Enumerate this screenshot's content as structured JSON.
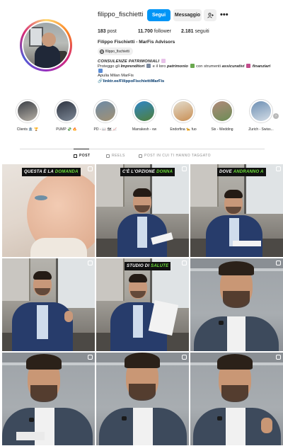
{
  "profile": {
    "username": "filippo_fischietti",
    "follow_label": "Segui",
    "message_label": "Messaggio",
    "add_user_icon": "add-user-icon",
    "more_icon": "•••",
    "stats": {
      "posts_value": "183",
      "posts_label": "post",
      "followers_value": "11.700",
      "followers_label": "follower",
      "following_value": "2.181",
      "following_label": "seguiti"
    },
    "full_name": "Filippo Fischietti - MarFis Advisors",
    "threads_handle": "filippo_fischietti",
    "bio": {
      "line1": "CONSULENZE PATRIMONIALI",
      "line2_a": "Proteggo gli",
      "line2_b": "Imprenditori",
      "line2_c": "e il loro",
      "line2_d": "patrimonio",
      "line2_e": "con strumenti",
      "line2_f": "assicurativi",
      "line2_g": "finanziari",
      "line4": "Apulia Milan MarFis",
      "link": "linktr.ee/FilippoFischiettiMarFis"
    }
  },
  "highlights": [
    {
      "label": "Clients 🏦 🏆",
      "color1": "#3b3f46",
      "color2": "#b7b1a7"
    },
    {
      "label": "PUMP 💸 🔥",
      "color1": "#2e3441",
      "color2": "#7d8896"
    },
    {
      "label": "PD - 📖 🗺 📈",
      "color1": "#6d8aa6",
      "color2": "#a29173"
    },
    {
      "label": "Marrakesh - vw",
      "color1": "#2f86c6",
      "color2": "#4f7f3a"
    },
    {
      "label": "Endorfina 🐆 fuo",
      "color1": "#e3dccd",
      "color2": "#c98f54"
    },
    {
      "label": "Six - Wedding",
      "color1": "#b08a7a",
      "color2": "#6b8c55"
    },
    {
      "label": "Zurich - Swiss...",
      "color1": "#6d8fb3",
      "color2": "#d4dde6"
    }
  ],
  "tabs": {
    "posts": "POST",
    "reels": "REELS",
    "tagged": "POST IN CUI TI HANNO TAGGATO"
  },
  "posts": [
    {
      "caption_a": "QUESTA È LA",
      "caption_b": "DOMANDA"
    },
    {
      "caption_a": "C'È L'OPZIONE",
      "caption_b": "DONNA"
    },
    {
      "caption_a": "DOVE",
      "caption_b": "ANDRANNO A"
    },
    {
      "caption_a": "",
      "caption_b": ""
    },
    {
      "caption_a": "STUDIO DI",
      "caption_b": "SALUTE"
    },
    {
      "caption_a": "",
      "caption_b": ""
    },
    {
      "caption_a": "",
      "caption_b": ""
    },
    {
      "caption_a": "",
      "caption_b": ""
    },
    {
      "caption_a": "",
      "caption_b": ""
    }
  ],
  "colors": {
    "accent": "#0095f6",
    "caption_highlight": "#6de33b",
    "link": "#00376b"
  }
}
